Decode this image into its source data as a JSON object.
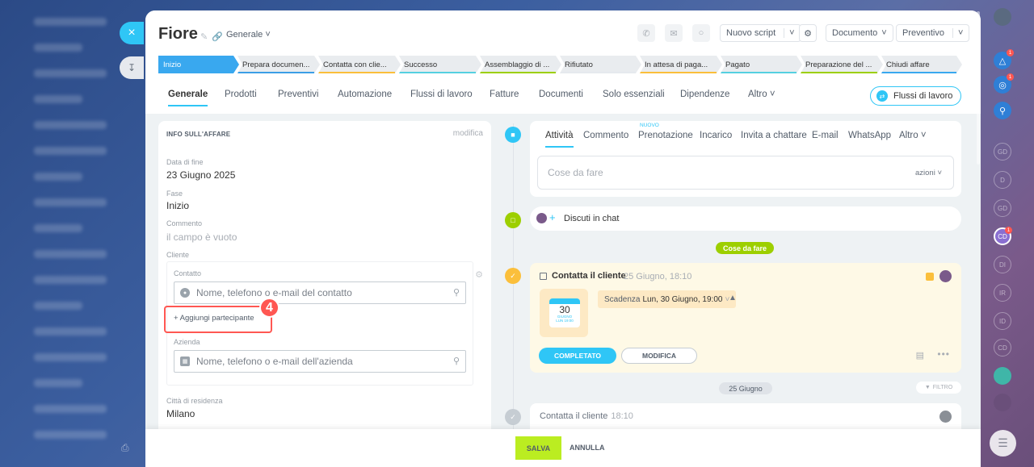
{
  "header": {
    "title": "Fiore",
    "category": "Generale",
    "buttons": {
      "new_script": "Nuovo script",
      "document": "Documento",
      "quote": "Preventivo"
    }
  },
  "stages": [
    {
      "label": "Inizio",
      "color": "#39a8ef"
    },
    {
      "label": "Prepara documen...",
      "color": "#3b9ee6"
    },
    {
      "label": "Contatta con clie...",
      "color": "#fbbf3b"
    },
    {
      "label": "Successo",
      "color": "#55d0e0"
    },
    {
      "label": "Assemblaggio di ...",
      "color": "#9dcf00"
    },
    {
      "label": "Rifiutato",
      "color": "#e6e9ee"
    },
    {
      "label": "In attesa di paga...",
      "color": "#fbbf3b"
    },
    {
      "label": "Pagato",
      "color": "#55d0e0"
    },
    {
      "label": "Preparazione del ...",
      "color": "#9dcf00"
    },
    {
      "label": "Chiudi affare",
      "color": "#39a8ef"
    }
  ],
  "tabs": [
    "Generale",
    "Prodotti",
    "Preventivi",
    "Automazione",
    "Flussi di lavoro",
    "Fatture",
    "Documenti",
    "Solo essenziali",
    "Dipendenze",
    "Altro"
  ],
  "workflow_button": "Flussi di lavoro",
  "deal_info": {
    "section_title": "INFO SULL'AFFARE",
    "edit_label": "modifica",
    "end_date_label": "Data di fine",
    "end_date": "23 Giugno 2025",
    "stage_label": "Fase",
    "stage": "Inizio",
    "comment_label": "Commento",
    "comment": "il campo è vuoto",
    "client_label": "Cliente",
    "contact_label": "Contatto",
    "contact_placeholder": "Nome, telefono o e-mail del contatto",
    "add_participant": "+ Aggiungi partecipante",
    "step_number": "4",
    "company_label": "Azienda",
    "company_placeholder": "Nome, telefono o e-mail dell'azienda",
    "city_label": "Città di residenza",
    "city": "Milano"
  },
  "activity": {
    "tabs": [
      "Attività",
      "Commento",
      "Prenotazione",
      "Incarico",
      "Invita a chattare",
      "E-mail",
      "WhatsApp",
      "Altro"
    ],
    "new_badge": "NUOVO",
    "todo_placeholder": "Cose da fare",
    "actions_label": "azioni",
    "chat_label": "Discuti in chat",
    "todo_pill": "Cose da fare"
  },
  "task": {
    "title": "Contatta il cliente",
    "date": "25 Giugno, 18:10",
    "calendar_day": "30",
    "calendar_month": "GIUGNO",
    "calendar_sub": "LUN 19:00",
    "deadline_label": "Scadenza",
    "deadline_value": "Lun, 30 Giugno, 19:00",
    "completed_button": "COMPLETATO",
    "edit_button": "MODIFICA"
  },
  "history": {
    "date_pill": "25 Giugno",
    "filter_label": "FILTRO",
    "title": "Contatta il cliente",
    "time": "18:10"
  },
  "footer": {
    "save": "SALVA",
    "cancel": "ANNULLA"
  },
  "right_bar": {
    "avatars": [
      "GD",
      "D",
      "GD",
      "CD",
      "DI",
      "IR",
      "ID",
      "CD"
    ]
  }
}
